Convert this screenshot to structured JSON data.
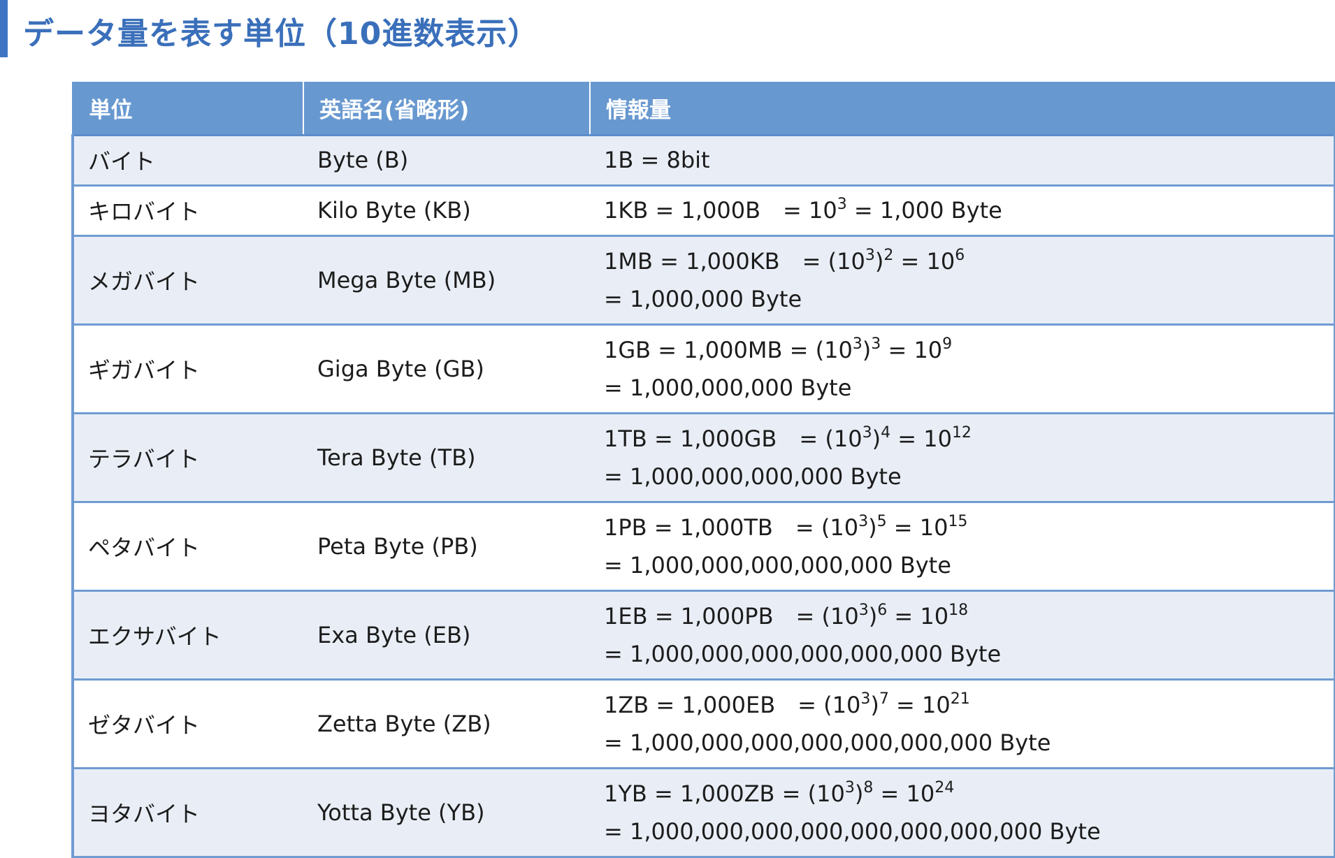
{
  "heading": {
    "title": "データ量を表す単位（10進数表示）"
  },
  "table": {
    "columns": [
      "単位",
      "英語名(省略形)",
      "情報量"
    ],
    "rows": [
      {
        "unit": "バイト",
        "english": "Byte (B)",
        "line1": [
          [
            "1B = 8bit",
            ""
          ]
        ],
        "line2": ""
      },
      {
        "unit": "キロバイト",
        "english": "Kilo Byte (KB)",
        "line1": [
          [
            "1KB = 1,000B　= 10",
            "3"
          ],
          [
            " = 1,000 Byte",
            ""
          ]
        ],
        "line2": ""
      },
      {
        "unit": "メガバイト",
        "english": "Mega Byte (MB)",
        "line1": [
          [
            "1MB = 1,000KB　= (10",
            "3"
          ],
          [
            ")",
            "2"
          ],
          [
            " = 10",
            "6"
          ]
        ],
        "line2": "= 1,000,000 Byte"
      },
      {
        "unit": "ギガバイト",
        "english": "Giga Byte (GB)",
        "line1": [
          [
            "1GB = 1,000MB = (10",
            "3"
          ],
          [
            ")",
            "3"
          ],
          [
            " = 10",
            "9"
          ]
        ],
        "line2": "= 1,000,000,000 Byte"
      },
      {
        "unit": "テラバイト",
        "english": "Tera Byte (TB)",
        "line1": [
          [
            "1TB = 1,000GB　= (10",
            "3"
          ],
          [
            ")",
            "4"
          ],
          [
            " = 10",
            "12"
          ]
        ],
        "line2": "= 1,000,000,000,000 Byte"
      },
      {
        "unit": "ペタバイト",
        "english": "Peta Byte (PB)",
        "line1": [
          [
            "1PB = 1,000TB　= (10",
            "3"
          ],
          [
            ")",
            "5"
          ],
          [
            " = 10",
            "15"
          ]
        ],
        "line2": "= 1,000,000,000,000,000 Byte"
      },
      {
        "unit": "エクサバイト",
        "english": "Exa Byte (EB)",
        "line1": [
          [
            "1EB = 1,000PB　= (10",
            "3"
          ],
          [
            ")",
            "6"
          ],
          [
            " = 10",
            "18"
          ]
        ],
        "line2": "= 1,000,000,000,000,000,000 Byte"
      },
      {
        "unit": "ゼタバイト",
        "english": "Zetta Byte (ZB)",
        "line1": [
          [
            "1ZB = 1,000EB　= (10",
            "3"
          ],
          [
            ")",
            "7"
          ],
          [
            " = 10",
            "21"
          ]
        ],
        "line2": "= 1,000,000,000,000,000,000,000 Byte"
      },
      {
        "unit": "ヨタバイト",
        "english": "Yotta Byte (YB)",
        "line1": [
          [
            "1YB = 1,000ZB = (10",
            "3"
          ],
          [
            ")",
            "8"
          ],
          [
            " = 10",
            "24"
          ]
        ],
        "line2": "= 1,000,000,000,000,000,000,000,000 Byte"
      }
    ]
  },
  "colors": {
    "accent": "#3f74c4",
    "header_bg": "#6898d0",
    "row_shade": "#e9eef6",
    "border": "#6f9bd2"
  }
}
